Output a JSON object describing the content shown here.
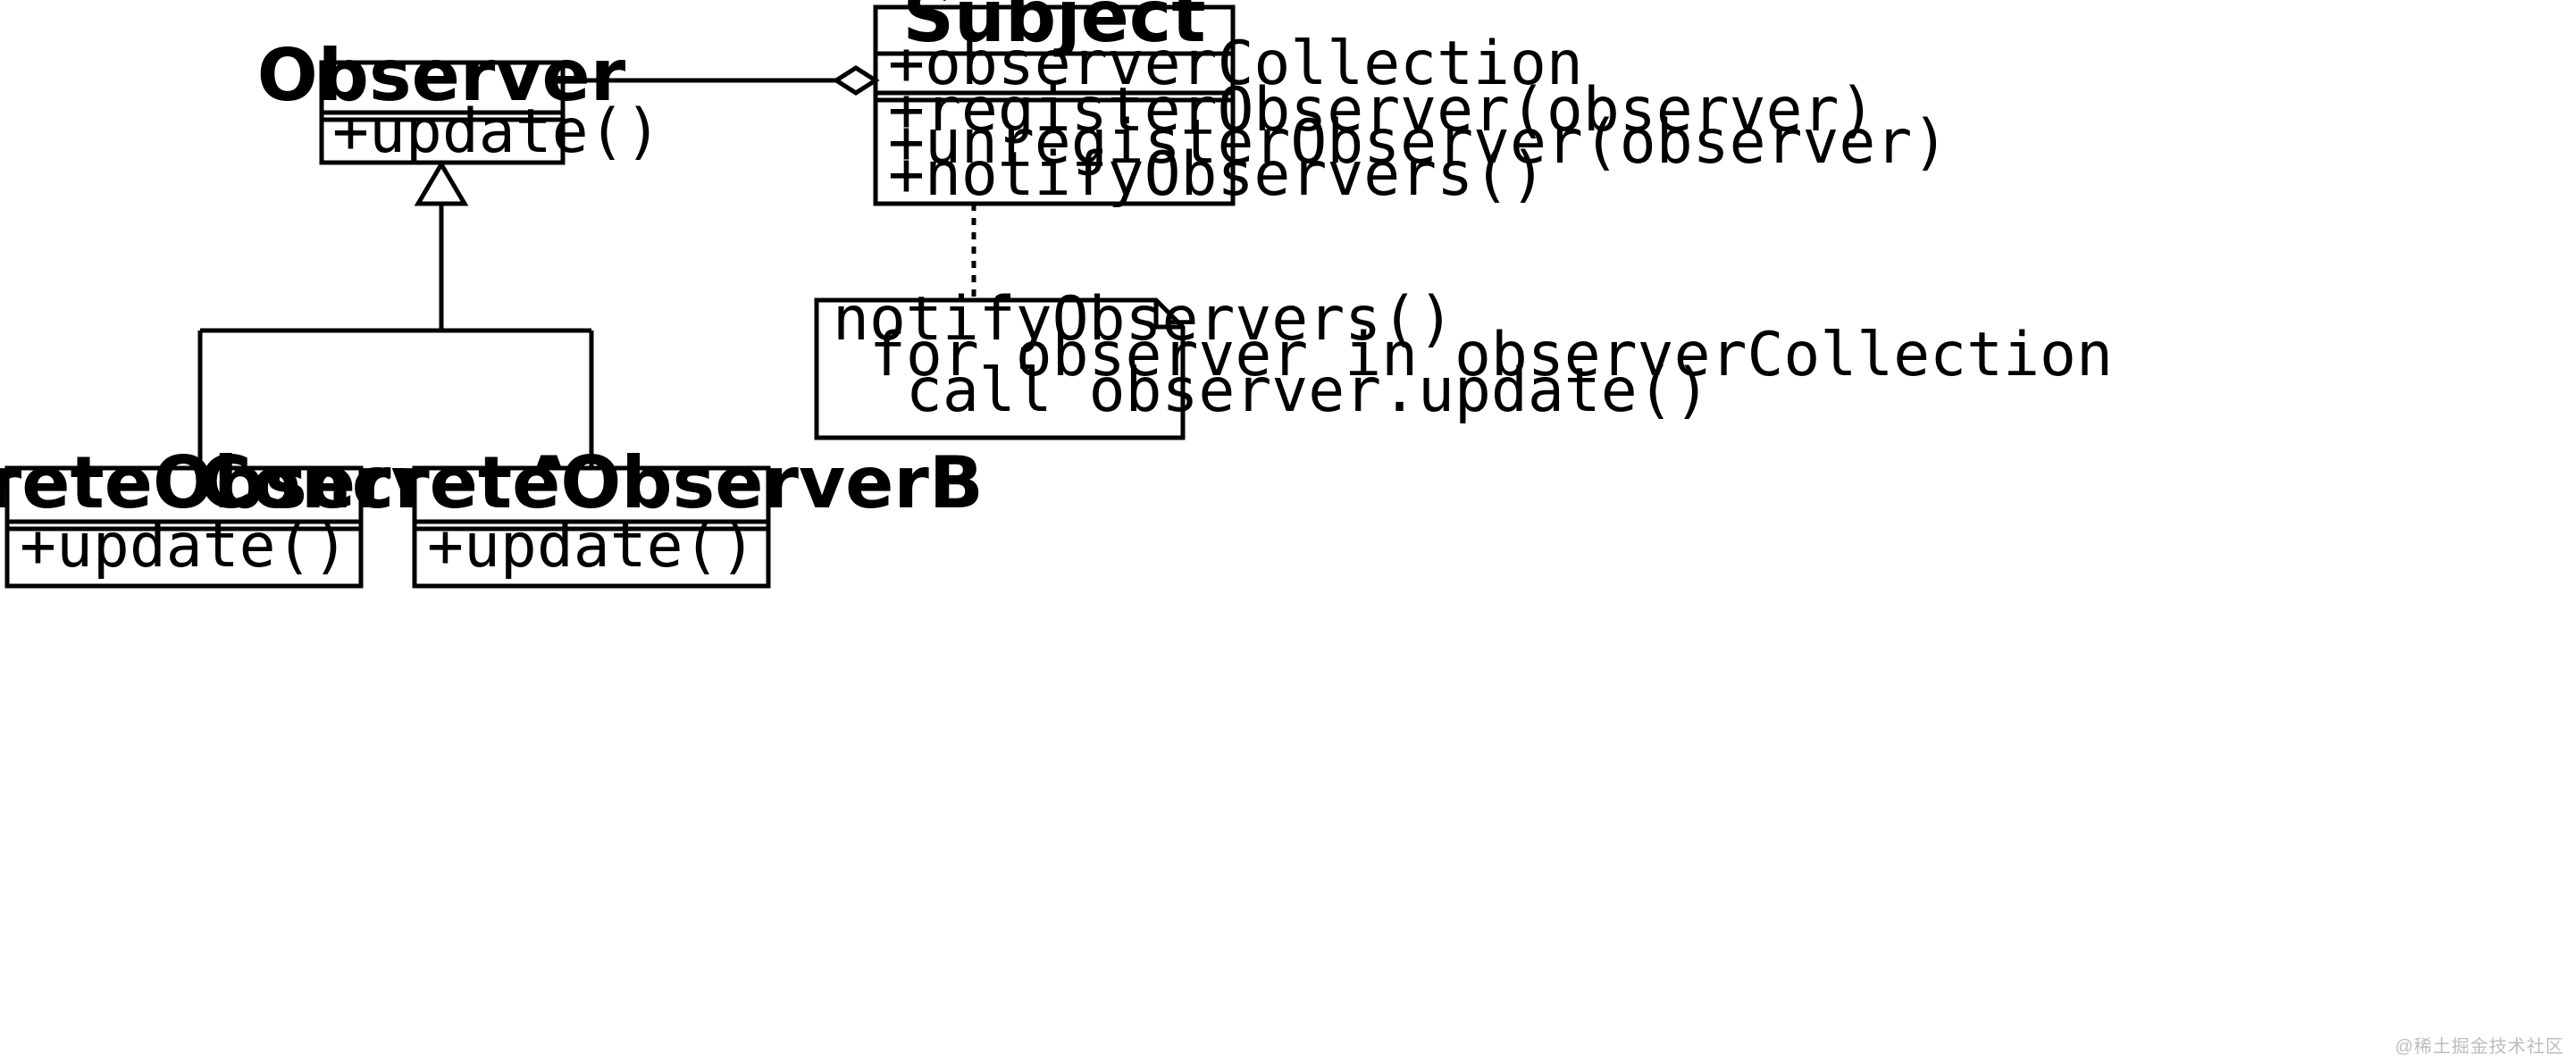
{
  "diagram": {
    "type": "uml-class-diagram",
    "pattern": "Observer",
    "classes": {
      "observer": {
        "name": "Observer",
        "attributes": [],
        "methods": [
          "+update()"
        ]
      },
      "subject": {
        "name": "Subject",
        "attributes": [
          "+observerCollection"
        ],
        "methods": [
          "+registerObserver(observer)",
          "+unregisterObserver(observer)",
          "+notifyObservers()"
        ]
      },
      "concreteA": {
        "name": "ConcreteObserverA",
        "attributes": [],
        "methods": [
          "+update()"
        ]
      },
      "concreteB": {
        "name": "ConcreteObserverB",
        "attributes": [],
        "methods": [
          "+update()"
        ]
      }
    },
    "note": {
      "lines": [
        "notifyObservers()",
        " for observer in observerCollection",
        "  call observer.update()"
      ]
    },
    "relations": [
      {
        "from": "Subject",
        "to": "Observer",
        "type": "aggregation"
      },
      {
        "from": "ConcreteObserverA",
        "to": "Observer",
        "type": "generalization"
      },
      {
        "from": "ConcreteObserverB",
        "to": "Observer",
        "type": "generalization"
      }
    ]
  },
  "watermark": "@稀土掘金技术社区"
}
